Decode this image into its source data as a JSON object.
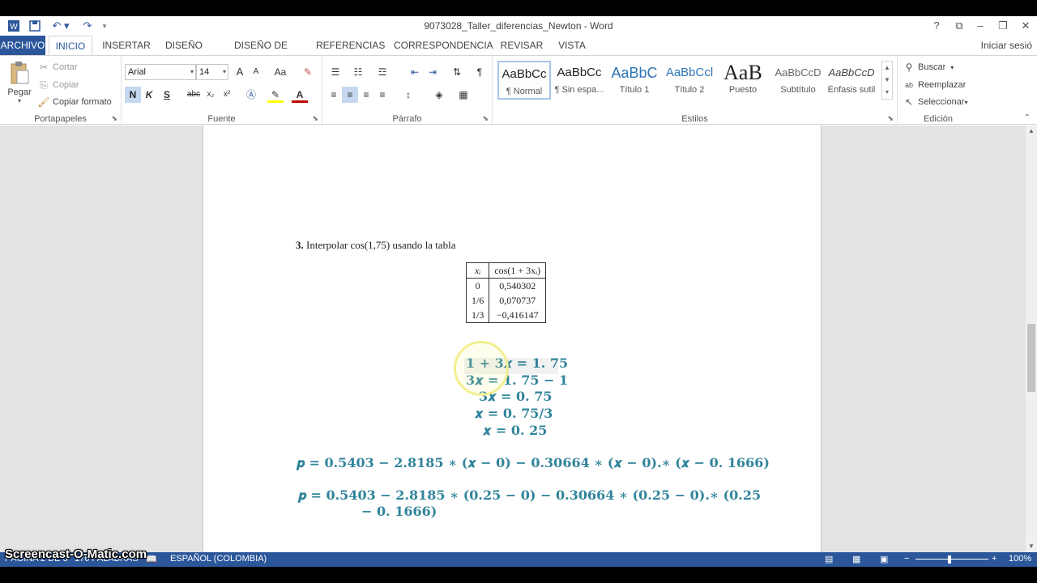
{
  "window": {
    "title": "9073028_Taller_diferencias_Newton - Word",
    "help": "?",
    "minimize": "–",
    "restore": "❐",
    "close": "✕"
  },
  "tabs": [
    {
      "label": "ARCHIVO"
    },
    {
      "label": "INICIO"
    },
    {
      "label": "INSERTAR"
    },
    {
      "label": "DISEÑO"
    },
    {
      "label": "DISEÑO DE PÁGINA"
    },
    {
      "label": "REFERENCIAS"
    },
    {
      "label": "CORRESPONDENCIA"
    },
    {
      "label": "REVISAR"
    },
    {
      "label": "VISTA"
    }
  ],
  "user_label": "Iniciar sesió",
  "ribbon": {
    "clipboard": {
      "group": "Portapapeles",
      "paste": "Pegar",
      "cut": "Cortar",
      "copy": "Copiar",
      "format_painter": "Copiar formato"
    },
    "font": {
      "group": "Fuente",
      "font_name": "Arial",
      "font_size": "14",
      "bold": "N",
      "italic": "K",
      "underline": "S",
      "strike": "abc",
      "subscript": "x₂",
      "superscript": "x²",
      "change_case": "Aa",
      "grow": "A",
      "shrink": "A"
    },
    "paragraph": {
      "group": "Párrafo"
    },
    "styles": {
      "group": "Estilos",
      "items": [
        {
          "preview": "AaBbCc",
          "name": "¶ Normal"
        },
        {
          "preview": "AaBbCc",
          "name": "¶ Sin espa..."
        },
        {
          "preview": "AaBbC",
          "name": "Título 1"
        },
        {
          "preview": "AaBbCcl",
          "name": "Título 2"
        },
        {
          "preview": "AaB",
          "name": "Puesto"
        },
        {
          "preview": "AaBbCcD",
          "name": "Subtítulo"
        },
        {
          "preview": "AaBbCcD",
          "name": "Énfasis sutil"
        }
      ]
    },
    "editing": {
      "group": "Edición",
      "find": "Buscar",
      "replace": "Reemplazar",
      "select": "Seleccionar"
    }
  },
  "document": {
    "question_number": "3.",
    "question_text": "Interpolar cos(1,75) usando la tabla",
    "table": {
      "headers": [
        "xᵢ",
        "cos(1 + 3xᵢ)"
      ],
      "rows": [
        [
          "0",
          "0,540302"
        ],
        [
          "1/6",
          "0,070737"
        ],
        [
          "1/3",
          "−0,416147"
        ]
      ]
    },
    "equations": [
      "1 + 3𝒙 = 1. 75",
      "3𝒙 = 1. 75 − 1",
      "3𝒙 = 0. 75",
      "𝒙 = 0. 75/3",
      "𝒙 = 0. 25"
    ],
    "formula1": "𝒑 =  0.5403 − 2.8185 ∗ (𝒙 − 0) − 0.30664 ∗ (𝒙 − 0).∗ (𝒙 − 0. 1666)",
    "formula2_line1": "𝒑 =  0.5403 − 2.8185 ∗ (0.25 − 0) − 0.30664 ∗ (0.25 − 0).∗ (0.25",
    "formula2_line2": "− 0. 1666)"
  },
  "status": {
    "page": "PÁGINA 2 DE 3",
    "words": "176 PALABRAS",
    "language": "ESPAÑOL (COLOMBIA)",
    "zoom": "100%"
  },
  "watermark": "Screencast-O-Matic.com",
  "colors": {
    "accent": "#2b579a",
    "equation": "#31849b"
  }
}
